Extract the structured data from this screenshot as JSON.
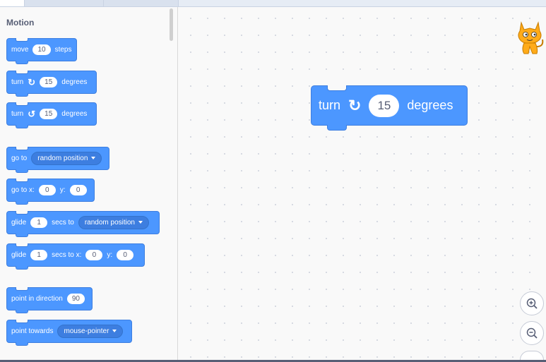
{
  "palette": {
    "category": "Motion",
    "blocks": [
      {
        "pre": "move",
        "v1": "10",
        "post": "steps"
      },
      {
        "pre": "turn",
        "v1": "15",
        "post": "degrees"
      },
      {
        "pre": "turn",
        "v1": "15",
        "post": "degrees"
      },
      {
        "pre": "go to",
        "drop": "random position"
      },
      {
        "pre": "go to x:",
        "v1": "0",
        "mid": "y:",
        "v2": "0"
      },
      {
        "pre": "glide",
        "v1": "1",
        "mid": "secs to",
        "drop": "random position"
      },
      {
        "pre": "glide",
        "v1": "1",
        "mid": "secs to x:",
        "v2": "0",
        "mid2": "y:",
        "v3": "0"
      },
      {
        "pre": "point in direction",
        "v1": "90"
      },
      {
        "pre": "point towards",
        "drop": "mouse-pointer"
      }
    ]
  },
  "workspace": {
    "block": {
      "pre": "turn",
      "value": "15",
      "post": "degrees"
    }
  },
  "colors": {
    "motion": "#4c97ff",
    "motion_dark": "#3d7ee0",
    "text": "#575e75"
  },
  "icons": {
    "turn_right": "rotate-right-icon",
    "turn_left": "rotate-left-icon",
    "zoom_in": "zoom-in-icon",
    "zoom_out": "zoom-out-icon",
    "sprite": "scratch-cat-sprite"
  }
}
